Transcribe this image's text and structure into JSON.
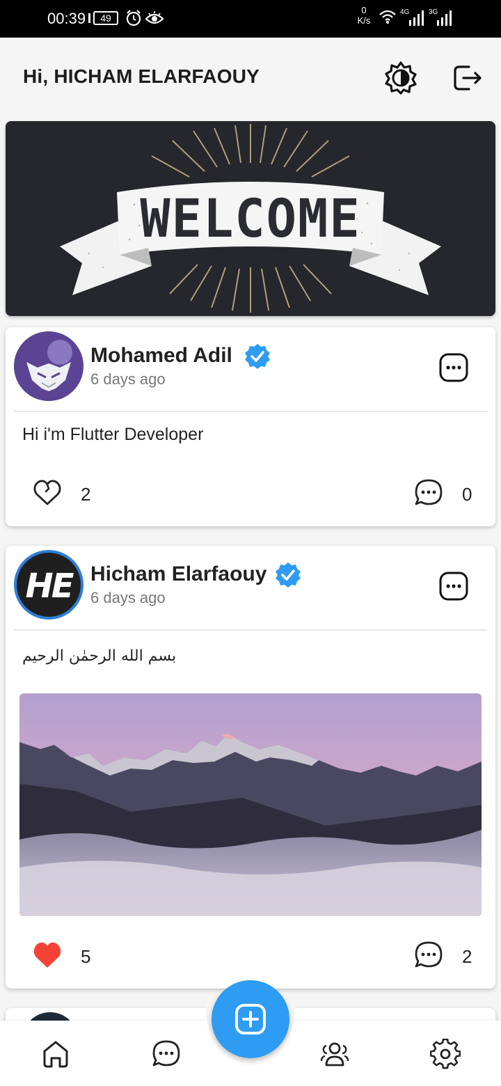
{
  "status_bar": {
    "time": "00:39",
    "battery": "49",
    "net_speed_value": "0",
    "net_speed_unit": "K/s",
    "sig1": "4G",
    "sig2": "3G"
  },
  "header": {
    "greeting": "Hi, HICHAM ELARFAOUY"
  },
  "banner": {
    "text": "WELCOME"
  },
  "posts": [
    {
      "author": "Mohamed Adil",
      "time": "6 days ago",
      "text": "Hi i'm Flutter Developer",
      "likes": "2",
      "comments": "0",
      "liked": false,
      "has_image": false
    },
    {
      "author": "Hicham Elarfaouy",
      "avatar_text": "HE",
      "time": "6 days ago",
      "text": "بسم الله الرحمٰن الرحيم",
      "likes": "5",
      "comments": "2",
      "liked": true,
      "has_image": true
    }
  ],
  "colors": {
    "accent": "#2e9cf2",
    "verified": "#2e9cf2",
    "liked": "#f44336",
    "banner_bg": "#25272c"
  },
  "icons": {
    "theme": "brightness-icon",
    "logout": "logout-icon",
    "more": "more-options-icon",
    "like": "heart-icon",
    "comment": "comment-icon",
    "verified": "verified-badge-icon",
    "fab": "add-post-icon",
    "nav": [
      "home-icon",
      "chat-icon",
      "users-icon",
      "settings-icon"
    ]
  }
}
